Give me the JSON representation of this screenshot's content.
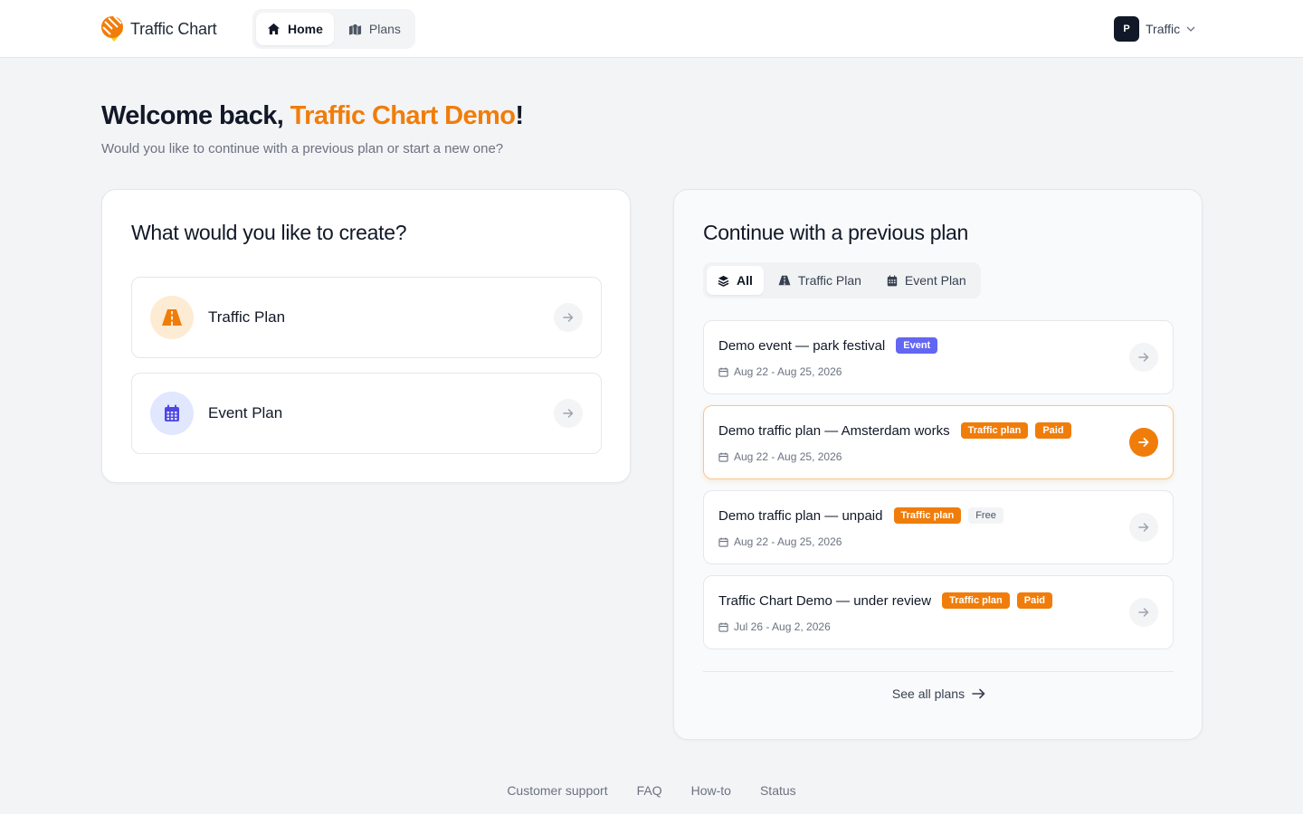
{
  "app": {
    "name": "Traffic Chart"
  },
  "nav": {
    "home_label": "Home",
    "plans_label": "Plans"
  },
  "account": {
    "initial": "P",
    "name": "Traffic"
  },
  "welcome": {
    "prefix": "Welcome back, ",
    "name": "Traffic Chart Demo",
    "suffix": "!",
    "subtitle": "Would you like to continue with a previous plan or start a new one?"
  },
  "create": {
    "title": "What would you like to create?",
    "options": [
      {
        "label": "Traffic Plan"
      },
      {
        "label": "Event Plan"
      }
    ]
  },
  "previous": {
    "title": "Continue with a previous plan",
    "filters": [
      {
        "label": "All"
      },
      {
        "label": "Traffic Plan"
      },
      {
        "label": "Event Plan"
      }
    ],
    "plans": [
      {
        "title": "Demo event — park festival",
        "badges": [
          "Event"
        ],
        "date": "Aug 22 - Aug 25, 2026"
      },
      {
        "title": "Demo traffic plan — Amsterdam works",
        "badges": [
          "Traffic plan",
          "Paid"
        ],
        "date": "Aug 22 - Aug 25, 2026"
      },
      {
        "title": "Demo traffic plan — unpaid",
        "badges": [
          "Traffic plan",
          "Free"
        ],
        "date": "Aug 22 - Aug 25, 2026"
      },
      {
        "title": "Traffic Chart Demo — under review",
        "badges": [
          "Traffic plan",
          "Paid"
        ],
        "date": "Jul 26 - Aug 2, 2026"
      }
    ],
    "see_all_label": "See all plans"
  },
  "footer": {
    "links": [
      "Customer support",
      "FAQ",
      "How-to",
      "Status"
    ]
  },
  "colors": {
    "accent": "#f07d0a",
    "event_badge": "#6366f1",
    "dark": "#111827"
  },
  "icons": {
    "logo": "traffic-chart-logo-icon",
    "home": "home-icon",
    "plans": "map-icon",
    "chevron": "chevron-down-icon",
    "traffic": "road-icon",
    "event": "calendar-icon",
    "layers": "layers-icon",
    "arrow": "arrow-right-icon"
  }
}
